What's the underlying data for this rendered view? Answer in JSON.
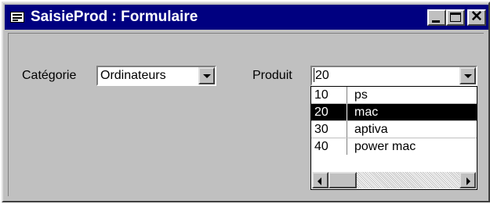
{
  "window": {
    "title": "SaisieProd : Formulaire",
    "icon": "form-icon",
    "controls": [
      "minimize-icon",
      "maximize-icon",
      "close-icon"
    ],
    "titlebar_color": "#000080"
  },
  "form": {
    "category": {
      "label": "Catégorie",
      "value": "Ordinateurs"
    },
    "product": {
      "label": "Produit",
      "value": "20",
      "options": [
        {
          "id": "10",
          "name": "ps",
          "selected": false
        },
        {
          "id": "20",
          "name": "mac",
          "selected": true
        },
        {
          "id": "30",
          "name": "aptiva",
          "selected": false
        },
        {
          "id": "40",
          "name": "power mac",
          "selected": false
        }
      ]
    }
  }
}
